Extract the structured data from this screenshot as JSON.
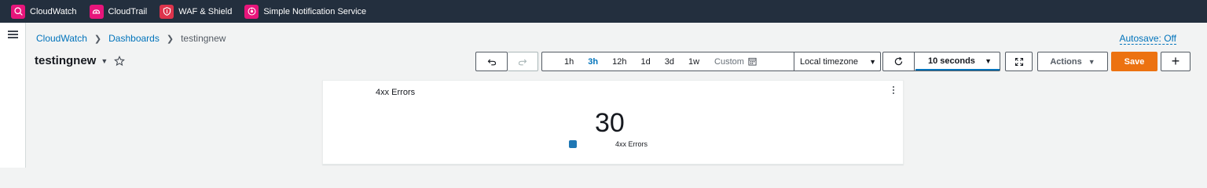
{
  "topbar": {
    "services": [
      {
        "label": "CloudWatch",
        "icon": "cloudwatch-icon"
      },
      {
        "label": "CloudTrail",
        "icon": "cloudtrail-icon"
      },
      {
        "label": "WAF & Shield",
        "icon": "waf-shield-icon"
      },
      {
        "label": "Simple Notification Service",
        "icon": "sns-icon"
      }
    ]
  },
  "breadcrumb": {
    "items": [
      "CloudWatch",
      "Dashboards",
      "testingnew"
    ]
  },
  "autosave_label": "Autosave: Off",
  "dashboard": {
    "title": "testingnew"
  },
  "toolbar": {
    "time_ranges": [
      "1h",
      "3h",
      "12h",
      "1d",
      "3d",
      "1w"
    ],
    "active_range": "3h",
    "custom_label": "Custom",
    "timezone": "Local timezone",
    "refresh_interval": "10 seconds",
    "actions_label": "Actions",
    "save_label": "Save",
    "add_label": "+"
  },
  "widget": {
    "title": "4xx Errors",
    "value": "30",
    "legend_label": "4xx Errors",
    "series_color": "#1f77b4"
  },
  "colors": {
    "topbar_bg": "#232f3e",
    "link": "#0073bb",
    "primary_button": "#ec7211",
    "service_icon": "#e7157b"
  }
}
